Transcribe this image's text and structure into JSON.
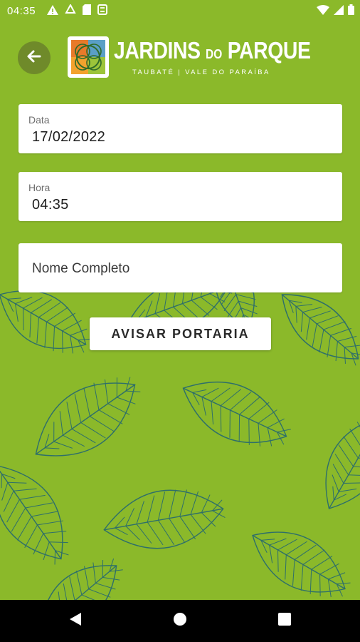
{
  "status_bar": {
    "time": "04:35",
    "left_icons": [
      "warning-icon",
      "recycle-icon",
      "sd-card-icon",
      "sync-icon"
    ],
    "right_icons": [
      "wifi-icon",
      "signal-icon",
      "battery-icon"
    ]
  },
  "header": {
    "back_icon": "arrow-left-icon",
    "brand_main": "JARDINS",
    "brand_small": "DO",
    "brand_end": "PARQUE",
    "brand_subtitle": "TAUBATÉ | VALE DO PARAÍBA"
  },
  "form": {
    "date": {
      "label": "Data",
      "value": "17/02/2022"
    },
    "time": {
      "label": "Hora",
      "value": "04:35"
    },
    "name": {
      "placeholder": "Nome Completo"
    }
  },
  "actions": {
    "notify_label": "AVISAR PORTARIA"
  },
  "nav_bar": {
    "icons": [
      "back-triangle-icon",
      "home-circle-icon",
      "recents-square-icon"
    ]
  },
  "colors": {
    "background": "#8bb92a",
    "leaf_line": "#2e6f6a",
    "back_button": "#6f8a2a",
    "field": "#ffffff"
  }
}
